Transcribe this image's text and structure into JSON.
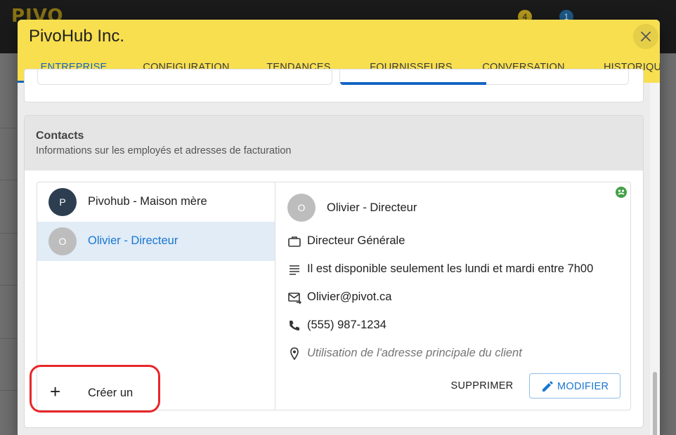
{
  "background": {
    "logo_text": "PIVO",
    "badge_counts": [
      "4",
      "1"
    ]
  },
  "dialog": {
    "title": "PivoHub Inc.",
    "close_icon": "close-icon",
    "tabs": [
      {
        "label": "ENTREPRISE",
        "active": true
      },
      {
        "label": "CONFIGURATION",
        "active": false
      },
      {
        "label": "TENDANCES",
        "active": false
      },
      {
        "label": "FOURNISSEURS",
        "active": false
      },
      {
        "label": "CONVERSATION",
        "active": false
      },
      {
        "label": "HISTORIQUE",
        "active": false
      }
    ],
    "accent_color": "#1565c0",
    "header_color": "#f7df4f"
  },
  "contacts": {
    "title": "Contacts",
    "subtitle": "Informations sur les employés et adresses de facturation",
    "list": [
      {
        "initial": "P",
        "label": "Pivohub - Maison mère",
        "selected": false,
        "avatar_color": "#2c3e50"
      },
      {
        "initial": "O",
        "label": "Olivier - Directeur",
        "selected": true,
        "avatar_color": "#bdbdbd"
      }
    ],
    "create_label": "Créer un",
    "detail": {
      "initial": "O",
      "name": "Olivier - Directeur",
      "status_icon": "status-online-icon",
      "job_title": "Directeur Générale",
      "note": "Il est disponible seulement les lundi et mardi entre 7h00",
      "email": "Olivier@pivot.ca",
      "phone": "(555) 987-1234",
      "address": "Utilisation de l'adresse principale du client",
      "delete_label": "SUPPRIMER",
      "edit_label": "MODIFIER"
    }
  }
}
